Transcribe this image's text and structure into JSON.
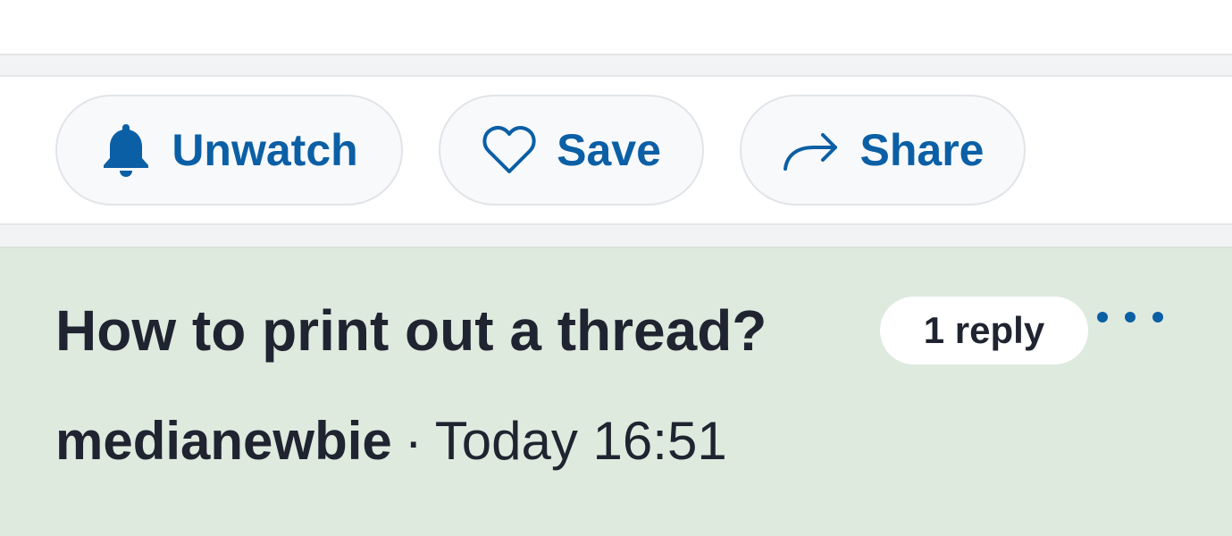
{
  "actions": {
    "unwatch_label": "Unwatch",
    "save_label": "Save",
    "share_label": "Share"
  },
  "post": {
    "title": "How to print out a thread?",
    "reply_count": "1 reply",
    "author": "medianewbie",
    "separator": "·",
    "timestamp": "Today 16:51"
  },
  "icons": {
    "unwatch": "bell-icon",
    "save": "heart-icon",
    "share": "share-arrow-icon",
    "more": "more-dots-icon"
  },
  "colors": {
    "accent": "#0b5fa5",
    "post_background": "#dfeadf",
    "text": "#1f2430"
  }
}
